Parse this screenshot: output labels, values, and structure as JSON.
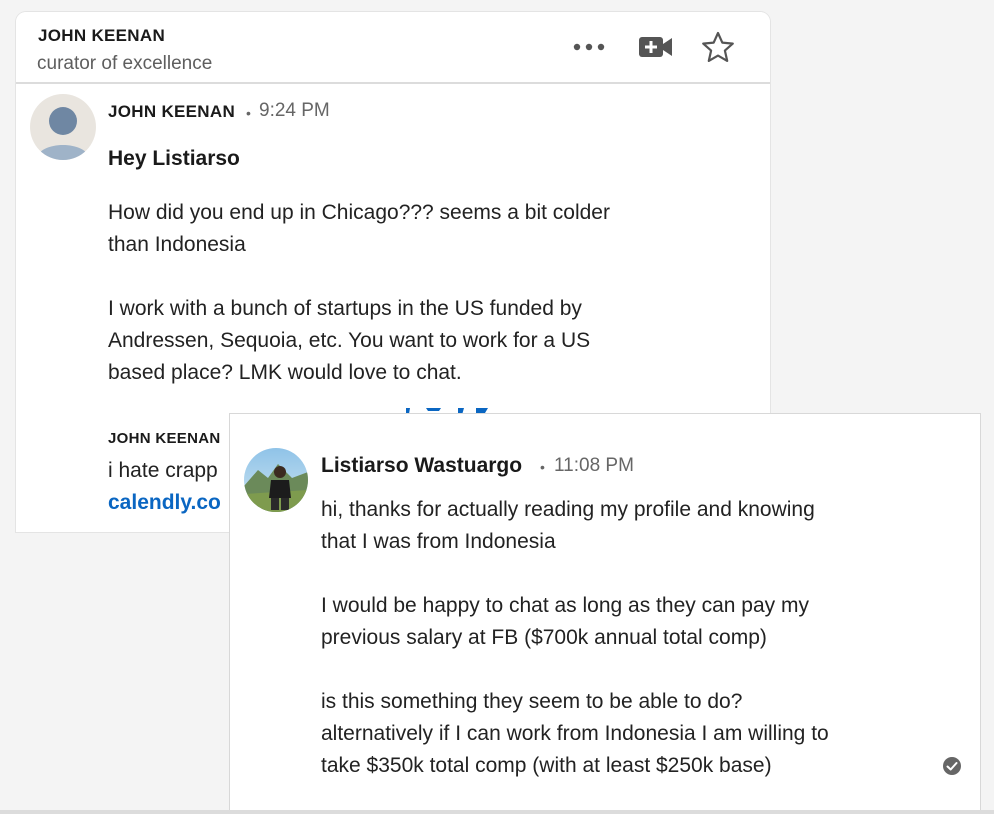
{
  "header": {
    "name": "JOHN KEENAN",
    "subtitle": "curator of excellence",
    "icons": [
      "more-options-icon",
      "video-call-icon",
      "star-icon"
    ]
  },
  "message1": {
    "sender": "JOHN KEENAN",
    "separator": "•",
    "time": "9:24 PM",
    "subject": "Hey Listiarso",
    "lines": [
      "How did you end up in Chicago??? seems a bit colder",
      "than Indonesia",
      "I work with a bunch of startups in the US funded by",
      "Andressen, Sequoia, etc. You want to work for a US",
      "based place? LMK would love to chat."
    ],
    "signature_name": "JOHN KEENAN",
    "signature_text": "i hate crapp",
    "signature_link": "calendly.co"
  },
  "message2": {
    "sender": "Listiarso Wastuargo",
    "separator": "•",
    "time": "11:08 PM",
    "lines": [
      "hi, thanks for actually reading my profile and knowing",
      "that I was from Indonesia",
      "I would be happy to chat as long as they can pay my",
      "previous salary at FB ($700k annual total comp)",
      "is this something they seem to be able to do?",
      "alternatively if I can work from Indonesia I am willing to",
      "take $350k total comp (with at least $250k base)"
    ],
    "status_icon": "read-receipt-check-icon"
  },
  "colors": {
    "link": "#0a66c2",
    "text": "#222222",
    "muted": "#666666"
  }
}
